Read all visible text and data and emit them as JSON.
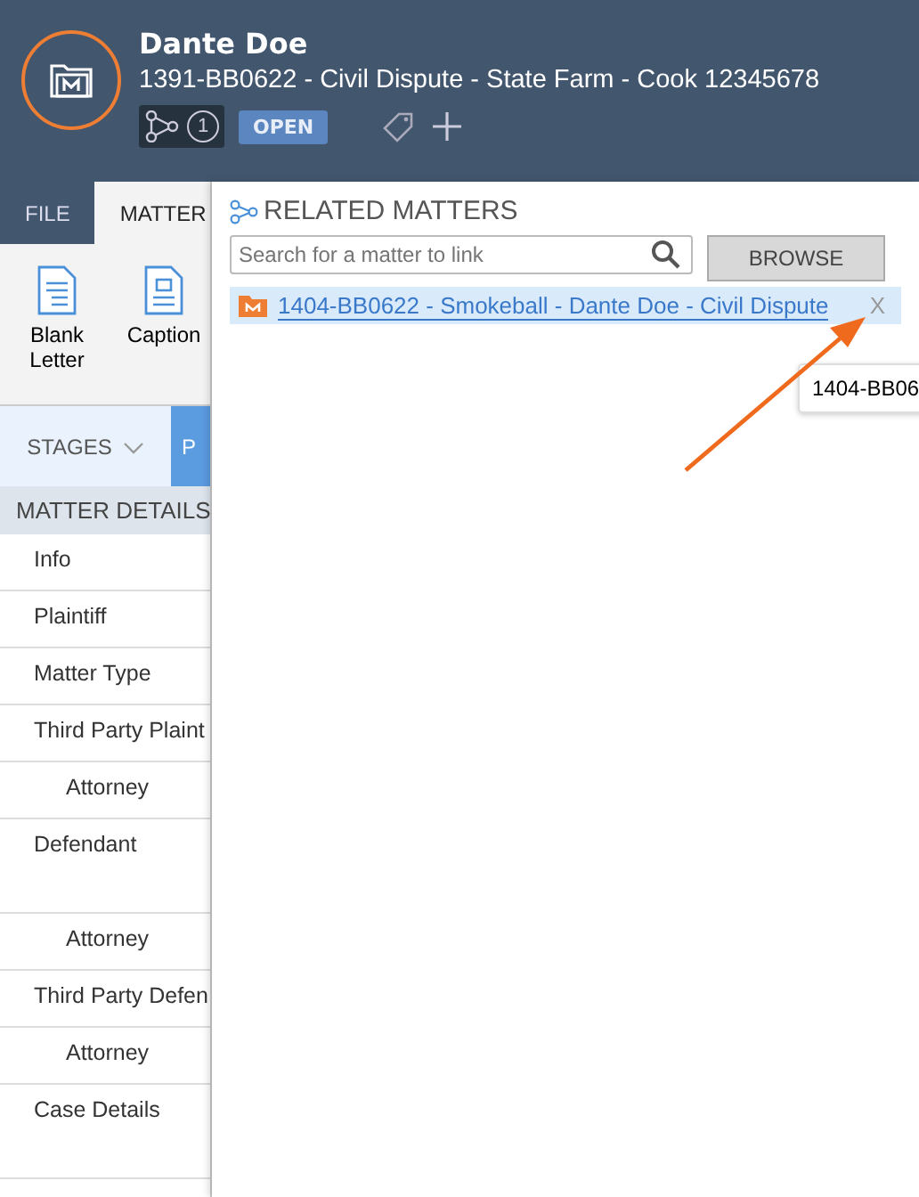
{
  "header": {
    "name": "Dante Doe",
    "subtitle": "1391-BB0622 - Civil Dispute - State Farm - Cook 12345678",
    "related_count": "1",
    "status": "OPEN"
  },
  "tabs": [
    {
      "label": "FILE",
      "selected": false
    },
    {
      "label": "MATTER",
      "selected": true
    }
  ],
  "ribbon": [
    {
      "label": "Blank Letter",
      "kind": "letter"
    },
    {
      "label": "Caption",
      "kind": "caption"
    }
  ],
  "stages": [
    {
      "label": "STAGES",
      "selected": false
    },
    {
      "label": "P",
      "selected": true
    }
  ],
  "details": {
    "title": "MATTER DETAILS",
    "items": [
      {
        "label": "Info",
        "tall": false
      },
      {
        "label": "Plaintiff",
        "tall": false
      },
      {
        "label": "Matter Type",
        "tall": false
      },
      {
        "label": "Third Party Plaint",
        "tall": false,
        "children": [
          {
            "label": "Attorney",
            "tall": false
          }
        ]
      },
      {
        "label": "Defendant",
        "tall": true,
        "children": [
          {
            "label": "Attorney",
            "tall": false
          }
        ]
      },
      {
        "label": "Third Party Defen",
        "tall": false,
        "children": [
          {
            "label": "Attorney",
            "tall": false
          }
        ]
      },
      {
        "label": "Case Details",
        "tall": true
      }
    ]
  },
  "related": {
    "title": "RELATED MATTERS",
    "search": {
      "placeholder": "Search for a matter to link"
    },
    "browse": "BROWSE",
    "matters": [
      {
        "label": "1404-BB0622 - Smokeball - Dante Doe - Civil Dispute",
        "remove": "X",
        "selected": true
      }
    ],
    "tooltip": "1404-BB06"
  }
}
